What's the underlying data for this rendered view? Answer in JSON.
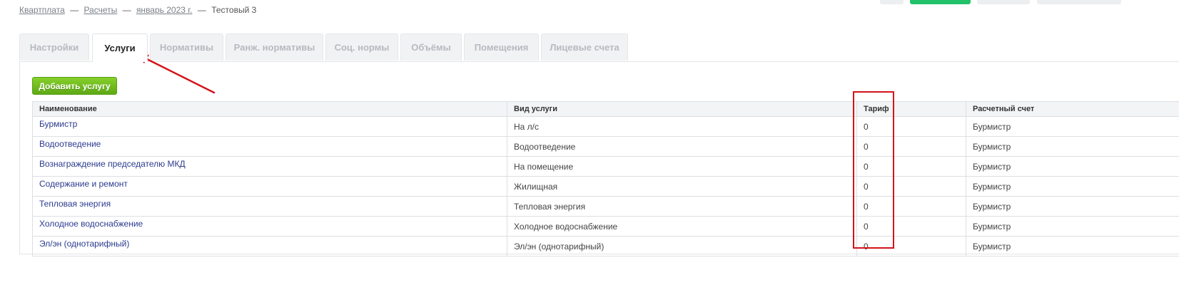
{
  "breadcrumb": {
    "items": [
      "Квартплата",
      "Расчеты",
      "январь 2023 г."
    ],
    "current": "Тестовый 3",
    "separator": "—"
  },
  "tabs": [
    {
      "label": "Настройки",
      "active": false
    },
    {
      "label": "Услуги",
      "active": true
    },
    {
      "label": "Нормативы",
      "active": false
    },
    {
      "label": "Ранж. нормативы",
      "active": false
    },
    {
      "label": "Соц. нормы",
      "active": false
    },
    {
      "label": "Объёмы",
      "active": false
    },
    {
      "label": "Помещения",
      "active": false
    },
    {
      "label": "Лицевые счета",
      "active": false
    }
  ],
  "toolbar": {
    "add_label": "Добавить услугу"
  },
  "table": {
    "columns": [
      "Наименование",
      "Вид услуги",
      "Тариф",
      "Расчетный счет"
    ],
    "rows": [
      [
        "Бурмистр",
        "На л/с",
        "0",
        "Бурмистр"
      ],
      [
        "Водоотведение",
        "Водоотведение",
        "0",
        "Бурмистр"
      ],
      [
        "Вознаграждение председателю МКД",
        "На помещение",
        "0",
        "Бурмистр"
      ],
      [
        "Содержание и ремонт",
        "Жилищная",
        "0",
        "Бурмистр"
      ],
      [
        "Тепловая энергия",
        "Тепловая энергия",
        "0",
        "Бурмистр"
      ],
      [
        "Холодное водоснабжение",
        "Холодное водоснабжение",
        "0",
        "Бурмистр"
      ],
      [
        "Эл/эн (однотарифный)",
        "Эл/эн (однотарифный)",
        "0",
        "Бурмистр"
      ]
    ]
  },
  "colors": {
    "annotation": "#d3141a",
    "link": "#2c3b8f",
    "add_button": "#6cbb1c",
    "top_green": "#21c26a"
  }
}
